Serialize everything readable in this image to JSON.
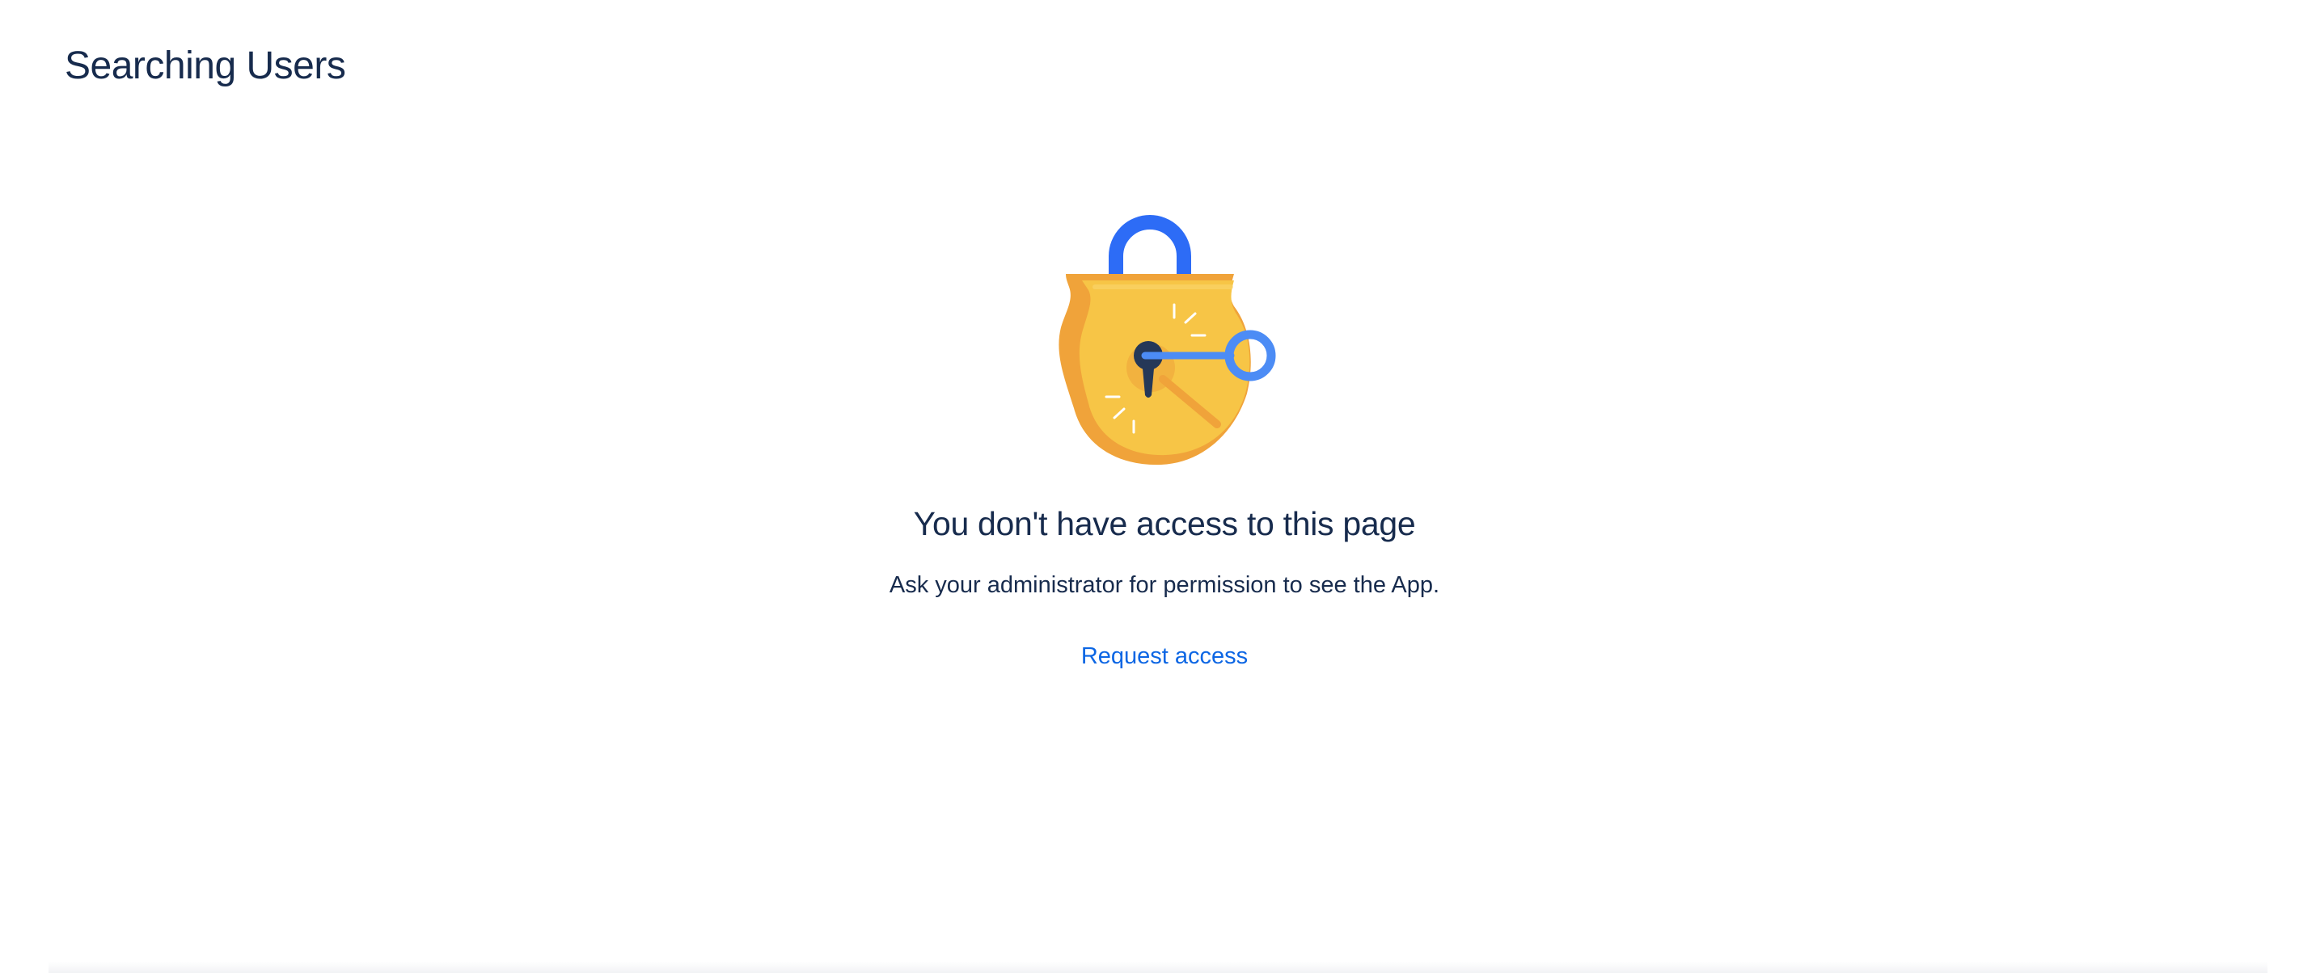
{
  "header": {
    "title": "Searching Users"
  },
  "empty_state": {
    "illustration_icon": "padlock-with-key-icon",
    "heading": "You don't have access to this page",
    "description": "Ask your administrator for permission to see the App.",
    "request_access_label": "Request access"
  },
  "colors": {
    "heading_text": "#172b4d",
    "link": "#0c66e4",
    "lock_shackle": "#2d6cf6",
    "lock_body": "#f7c546",
    "lock_body_shadow": "#f0a33a",
    "key": "#4c8cf5",
    "keyhole": "#253858"
  }
}
